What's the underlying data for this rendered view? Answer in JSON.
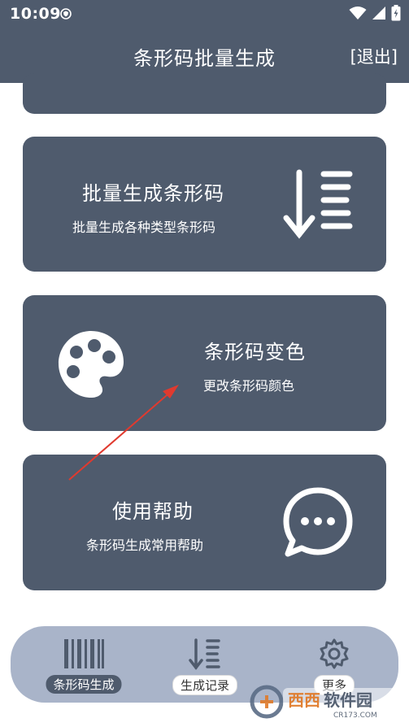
{
  "status_bar": {
    "time": "10:09"
  },
  "header": {
    "title": "条形码批量生成",
    "exit_label": "[退出]"
  },
  "cards": [
    {
      "title": "批量生成条形码",
      "subtitle": "批量生成各种类型条形码",
      "icon": "sort-list-down-icon"
    },
    {
      "title": "条形码变色",
      "subtitle": "更改条形码颜色",
      "icon": "palette-icon"
    },
    {
      "title": "使用帮助",
      "subtitle": "条形码生成常用帮助",
      "icon": "chat-bubble-icon"
    }
  ],
  "bottom_nav": [
    {
      "label": "条形码生成",
      "icon": "barcode-icon",
      "active": true
    },
    {
      "label": "生成记录",
      "icon": "sort-list-down-icon",
      "active": false
    },
    {
      "label": "更多",
      "icon": "gear-icon",
      "active": false
    }
  ],
  "watermark": {
    "brand": "西西软件园",
    "domain": "CR173.COM"
  },
  "colors": {
    "primary": "#4f5b6d",
    "nav_bg": "#a9b4c9",
    "annotation_arrow": "#e03a2f"
  }
}
